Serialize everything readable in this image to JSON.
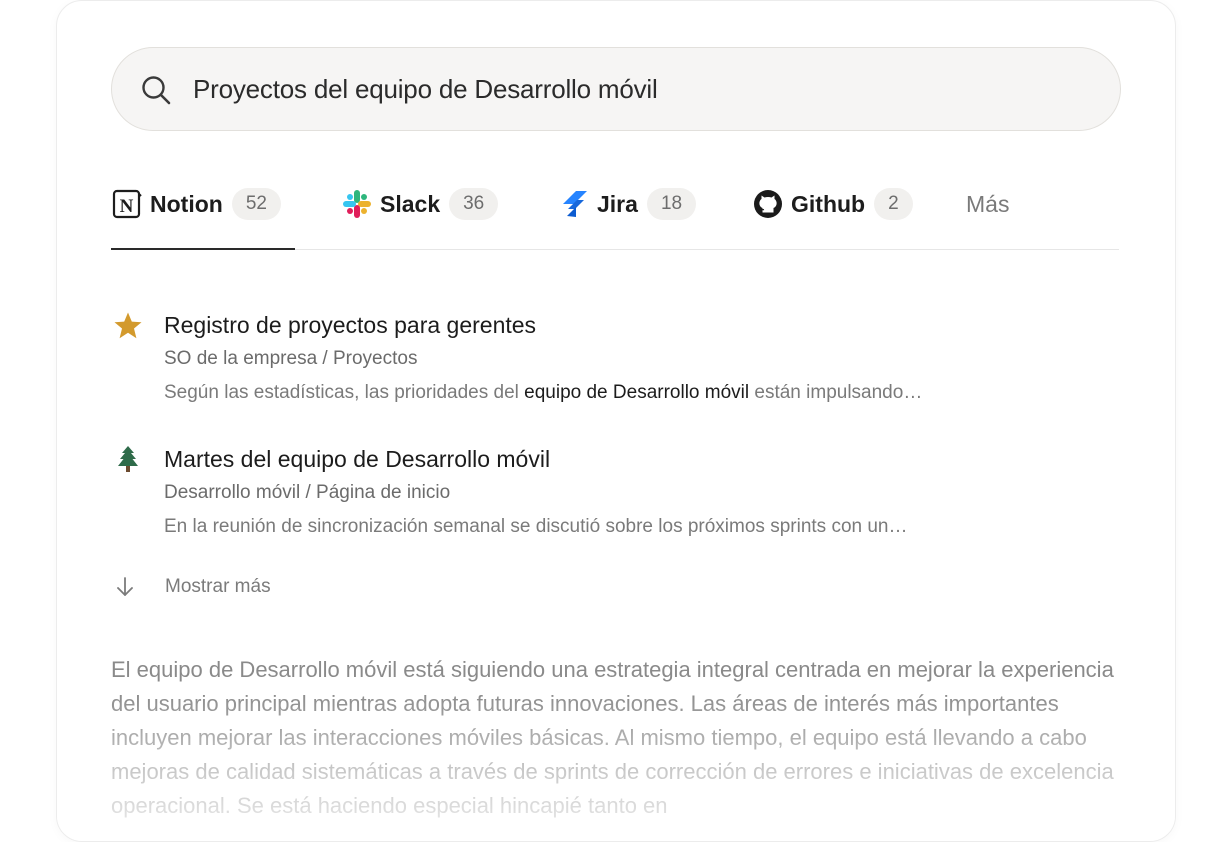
{
  "search": {
    "query": "Proyectos del equipo de Desarrollo móvil",
    "icon": "search-icon"
  },
  "tabs": [
    {
      "label": "Notion",
      "count": "52",
      "icon": "notion-icon",
      "active": true
    },
    {
      "label": "Slack",
      "count": "36",
      "icon": "slack-icon",
      "active": false
    },
    {
      "label": "Jira",
      "count": "18",
      "icon": "jira-icon",
      "active": false
    },
    {
      "label": "Github",
      "count": "2",
      "icon": "github-icon",
      "active": false
    },
    {
      "label": "Más",
      "active": false
    }
  ],
  "results": [
    {
      "icon": "star-icon",
      "title": "Registro de proyectos para gerentes",
      "path": "SO de la empresa / Proyectos",
      "snippet_pre": "Según las estadísticas, las prioridades del ",
      "snippet_highlight": "equipo de Desarrollo móvil",
      "snippet_post": " están impulsando…"
    },
    {
      "icon": "tree-icon",
      "title": "Martes del equipo de Desarrollo móvil",
      "path": "Desarrollo móvil / Página de inicio",
      "snippet": "En la reunión de sincronización semanal se discutió sobre los próximos sprints con un…"
    }
  ],
  "show_more": {
    "label": "Mostrar más",
    "icon": "arrow-down-icon"
  },
  "summary": "El equipo de Desarrollo móvil está siguiendo una estrategia integral centrada en mejorar la experiencia del usuario principal mientras adopta futuras innovaciones. Las áreas de interés más importantes incluyen mejorar las interacciones móviles básicas. Al mismo tiempo, el equipo está llevando a cabo mejoras de calidad sistemáticas a través de sprints de corrección de errores e iniciativas de excelencia operacional. Se está haciendo especial hincapié tanto en",
  "colors": {
    "star": "#d39a2d",
    "tree": "#2f6b4a",
    "jira": "#2684ff",
    "slack_green": "#2eb67d",
    "slack_blue": "#36c5f0",
    "slack_yellow": "#ecb22e",
    "slack_red": "#e01e5a"
  }
}
